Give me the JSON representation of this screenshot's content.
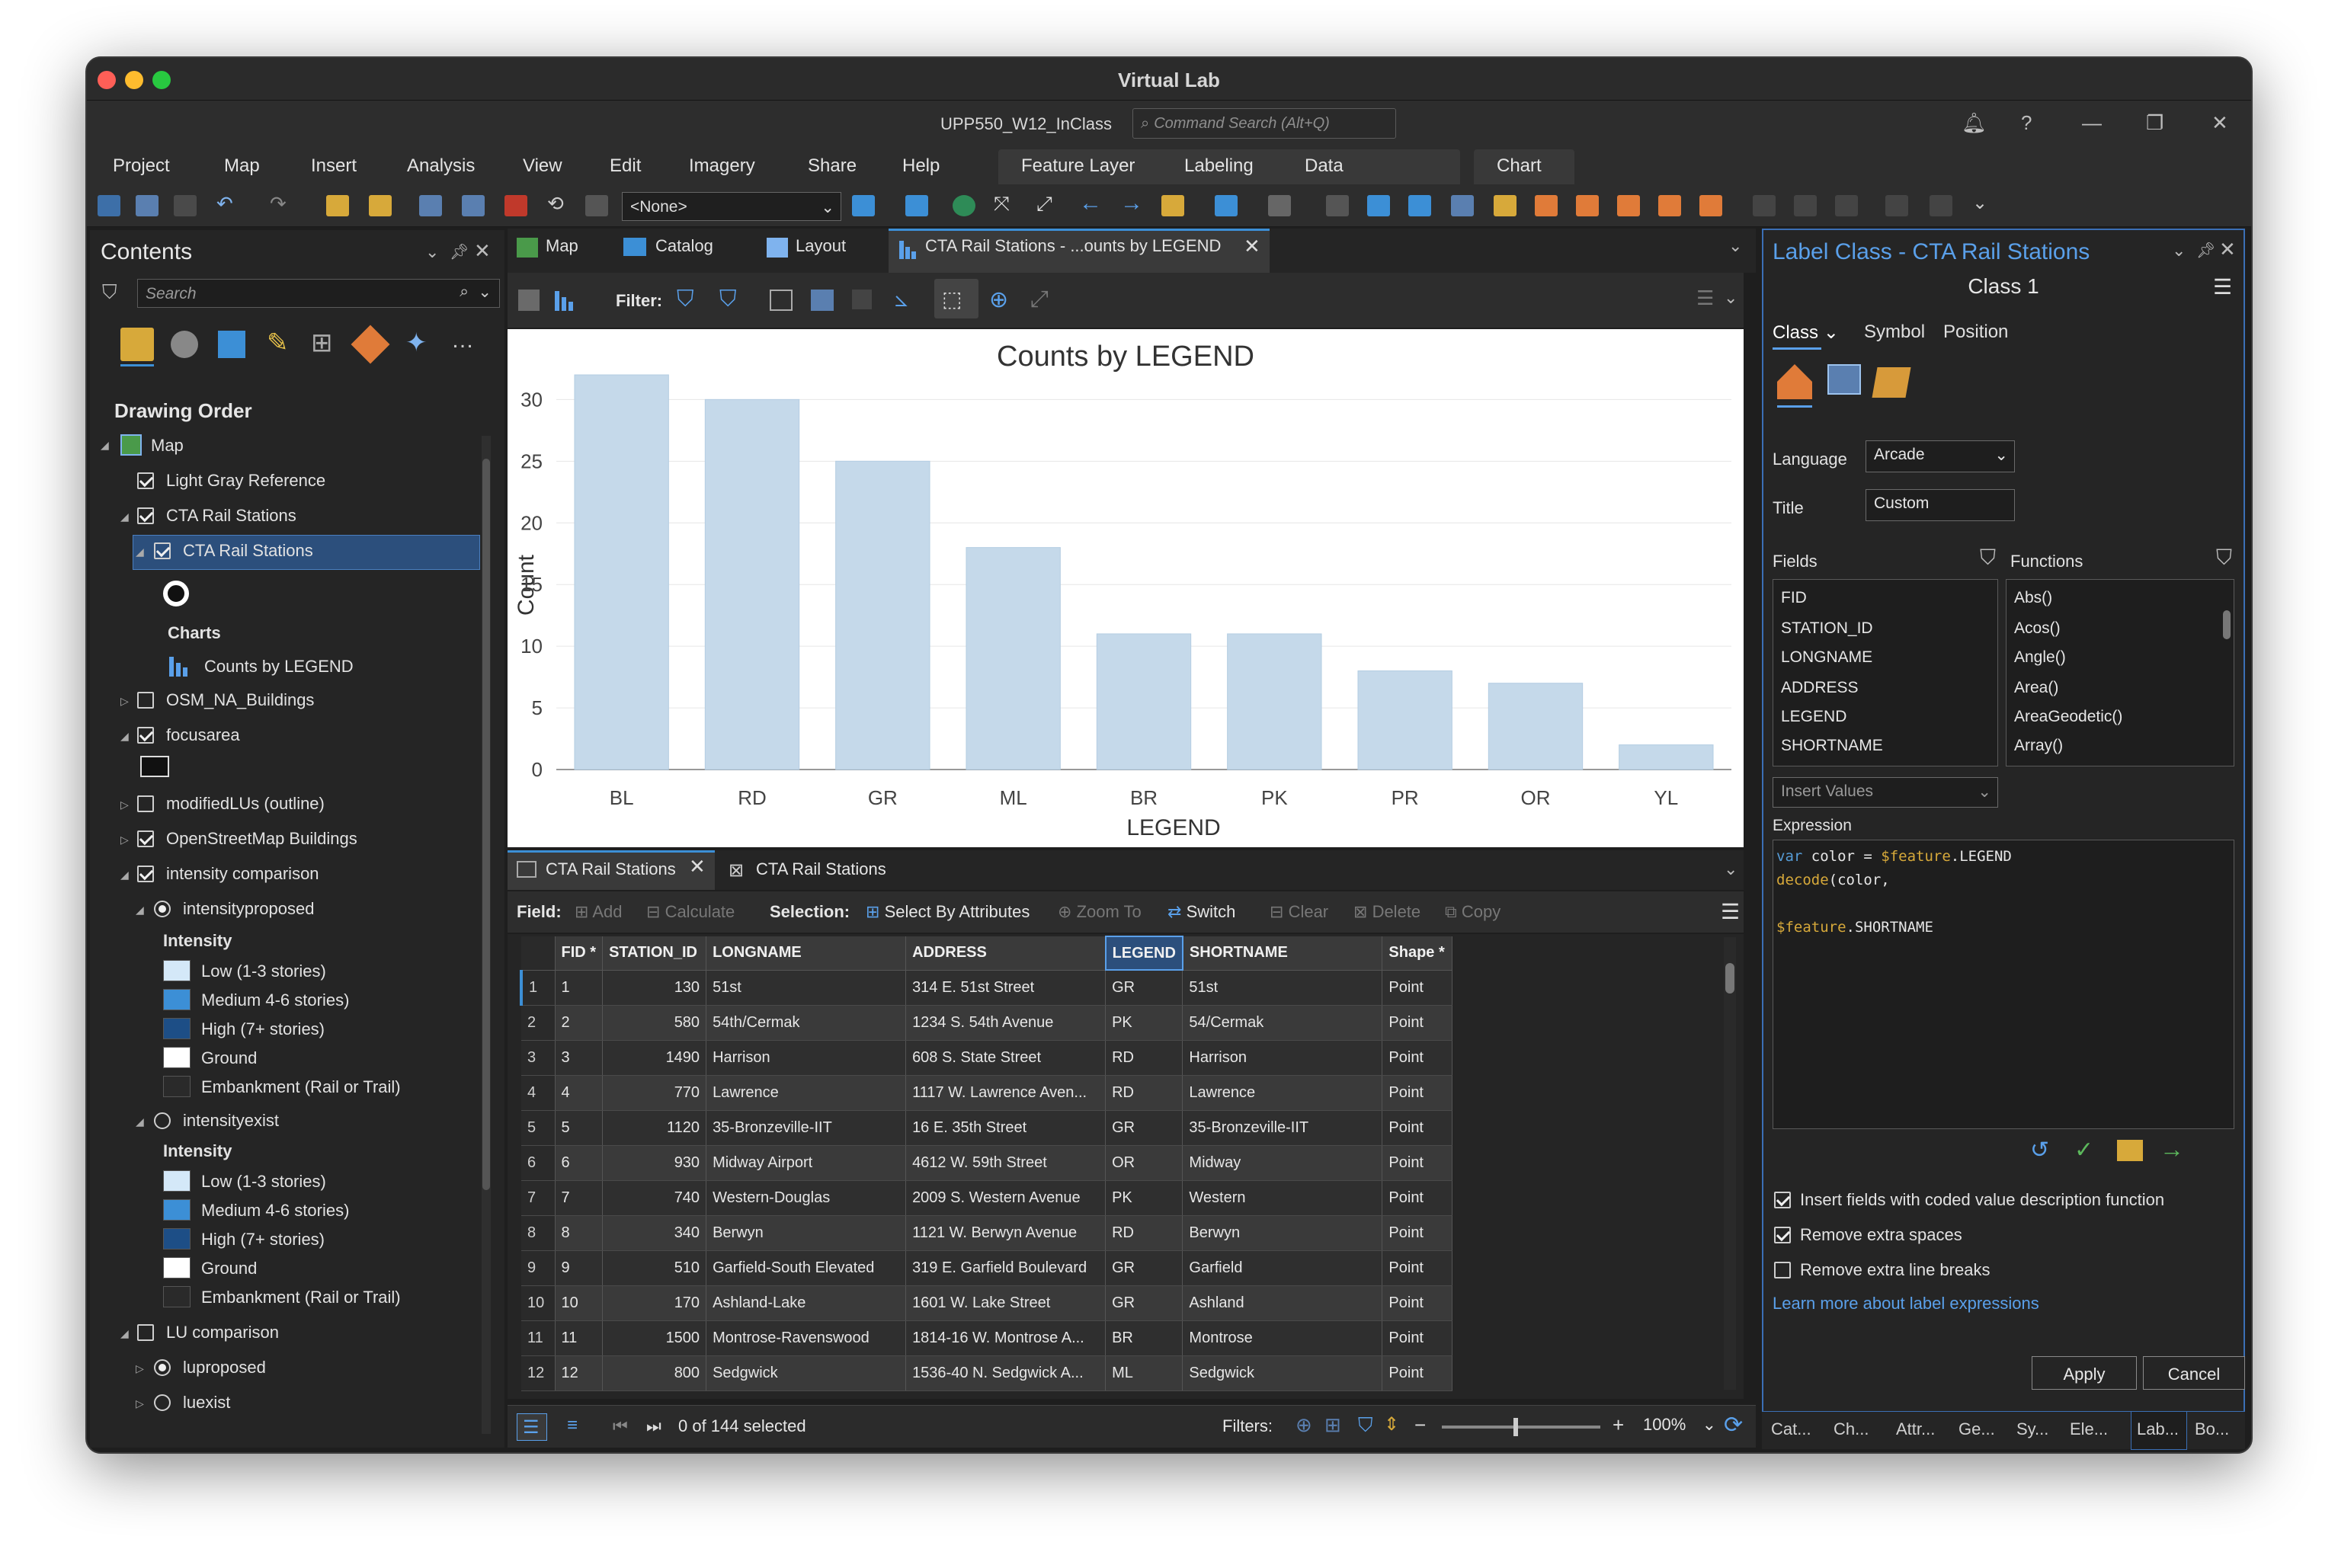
{
  "window": {
    "title": "Virtual Lab",
    "project_title": "UPP550_W12_InClass",
    "command_search_placeholder": "Command Search (Alt+Q)"
  },
  "menu": [
    "Project",
    "Map",
    "Insert",
    "Analysis",
    "View",
    "Edit",
    "Imagery",
    "Share",
    "Help"
  ],
  "context_tabs": [
    "Feature Layer",
    "Labeling",
    "Data",
    "Chart"
  ],
  "toolbar": {
    "layer_combo": "<None>"
  },
  "contents": {
    "title": "Contents",
    "search_placeholder": "Search",
    "section": "Drawing Order",
    "items": {
      "map": "Map",
      "light_gray": "Light Gray Reference",
      "cta_group": "CTA Rail Stations",
      "cta_layer": "CTA Rail Stations",
      "charts_label": "Charts",
      "chart_name": "Counts by LEGEND",
      "osm_buildings": "OSM_NA_Buildings",
      "focusarea": "focusarea",
      "modified": "modifiedLUs (outline)",
      "osm_map_buildings": "OpenStreetMap Buildings",
      "intensity_comparison": "intensity comparison",
      "intensityproposed": "intensityproposed",
      "intensity_label_1": "Intensity",
      "low_1": "Low (1-3 stories)",
      "medium_1": "Medium 4-6 stories)",
      "high_1": "High (7+ stories)",
      "ground_1": "Ground",
      "embankment_1": "Embankment (Rail or Trail)",
      "intensityexist": "intensityexist",
      "intensity_label_2": "Intensity",
      "low_2": "Low (1-3 stories)",
      "medium_2": "Medium 4-6 stories)",
      "high_2": "High (7+ stories)",
      "ground_2": "Ground",
      "embankment_2": "Embankment (Rail or Trail)",
      "lu_comparison": "LU comparison",
      "luproposed": "luproposed",
      "luexist": "luexist"
    },
    "colors": {
      "low": "#d4e8f8",
      "medium": "#3c8fd6",
      "high": "#1d4e86",
      "ground": "#ffffff",
      "embankment": "#2a2a2a"
    }
  },
  "doc_tabs": {
    "map": "Map",
    "catalog": "Catalog",
    "layout": "Layout",
    "chart": "CTA Rail Stations - ...ounts by LEGEND"
  },
  "chart_toolbar": {
    "filter_label": "Filter:"
  },
  "chart_data": {
    "type": "bar",
    "title": "Counts by LEGEND",
    "xlabel": "LEGEND",
    "ylabel": "Count",
    "categories": [
      "BL",
      "RD",
      "GR",
      "ML",
      "BR",
      "PK",
      "PR",
      "OR",
      "YL"
    ],
    "values": [
      32,
      30,
      25,
      18,
      11,
      11,
      8,
      7,
      2
    ],
    "ylim": [
      0,
      32
    ],
    "yticks": [
      "0",
      "5",
      "10",
      "15",
      "20",
      "25",
      "30"
    ],
    "bar_color": "#c5d9ea",
    "grid": true
  },
  "table_tabs": {
    "tab1": "CTA Rail Stations",
    "tab2": "CTA Rail Stations"
  },
  "table_toolbar": {
    "field_label": "Field:",
    "add": "Add",
    "calculate": "Calculate",
    "selection_label": "Selection:",
    "select_by_attributes": "Select By Attributes",
    "zoom_to": "Zoom To",
    "switch": "Switch",
    "clear": "Clear",
    "delete": "Delete",
    "copy": "Copy"
  },
  "table": {
    "columns": [
      "FID *",
      "STATION_ID",
      "LONGNAME",
      "ADDRESS",
      "LEGEND",
      "SHORTNAME",
      "Shape *"
    ],
    "rows": [
      [
        "1",
        "1",
        "130",
        "51st",
        "314 E. 51st Street",
        "GR",
        "51st",
        "Point"
      ],
      [
        "2",
        "2",
        "580",
        "54th/Cermak",
        "1234 S. 54th Avenue",
        "PK",
        "54/Cermak",
        "Point"
      ],
      [
        "3",
        "3",
        "1490",
        "Harrison",
        "608 S. State Street",
        "RD",
        "Harrison",
        "Point"
      ],
      [
        "4",
        "4",
        "770",
        "Lawrence",
        "1117 W. Lawrence Aven...",
        "RD",
        "Lawrence",
        "Point"
      ],
      [
        "5",
        "5",
        "1120",
        "35-Bronzeville-IIT",
        "16 E. 35th Street",
        "GR",
        "35-Bronzeville-IIT",
        "Point"
      ],
      [
        "6",
        "6",
        "930",
        "Midway Airport",
        "4612 W. 59th Street",
        "OR",
        "Midway",
        "Point"
      ],
      [
        "7",
        "7",
        "740",
        "Western-Douglas",
        "2009 S. Western Avenue",
        "PK",
        "Western",
        "Point"
      ],
      [
        "8",
        "8",
        "340",
        "Berwyn",
        "1121 W. Berwyn Avenue",
        "RD",
        "Berwyn",
        "Point"
      ],
      [
        "9",
        "9",
        "510",
        "Garfield-South Elevated",
        "319 E. Garfield Boulevard",
        "GR",
        "Garfield",
        "Point"
      ],
      [
        "10",
        "10",
        "170",
        "Ashland-Lake",
        "1601 W. Lake Street",
        "GR",
        "Ashland",
        "Point"
      ],
      [
        "11",
        "11",
        "1500",
        "Montrose-Ravenswood",
        "1814-16 W. Montrose A...",
        "BR",
        "Montrose",
        "Point"
      ],
      [
        "12",
        "12",
        "800",
        "Sedgwick",
        "1536-40 N. Sedgwick A...",
        "ML",
        "Sedgwick",
        "Point"
      ]
    ]
  },
  "status": {
    "selected": "0 of 144 selected",
    "filters_label": "Filters:",
    "zoom": "100%"
  },
  "label_class": {
    "pane_title": "Label Class - CTA Rail Stations",
    "class_name": "Class 1",
    "tabs": [
      "Class",
      "Symbol",
      "Position"
    ],
    "language_label": "Language",
    "language_value": "Arcade",
    "title_label": "Title",
    "title_value": "Custom",
    "fields_label": "Fields",
    "functions_label": "Functions",
    "fields": [
      "FID",
      "STATION_ID",
      "LONGNAME",
      "ADDRESS",
      "LEGEND",
      "SHORTNAME"
    ],
    "functions": [
      "Abs()",
      "Acos()",
      "Angle()",
      "Area()",
      "AreaGeodetic()",
      "Array()"
    ],
    "insert_values_placeholder": "Insert Values",
    "expression_label": "Expression",
    "expr_line1_kw": "var",
    "expr_line1_rest": " color = ",
    "expr_line1_feat": "$feature",
    "expr_line1_end": ".LEGEND",
    "expr_line2_fn": "decode",
    "expr_line2_rest": "(color,",
    "expr_line3_feat": "$feature",
    "expr_line3_end": ".SHORTNAME",
    "opt_coded": "Insert fields with coded value description function",
    "opt_spaces": "Remove extra spaces",
    "opt_breaks": "Remove extra line breaks",
    "learn_more": "Learn more about label expressions",
    "apply": "Apply",
    "cancel": "Cancel"
  },
  "bottom_tabs": [
    "Cat...",
    "Ch...",
    "Attr...",
    "Ge...",
    "Sy...",
    "Ele...",
    "Lab...",
    "Bo..."
  ]
}
